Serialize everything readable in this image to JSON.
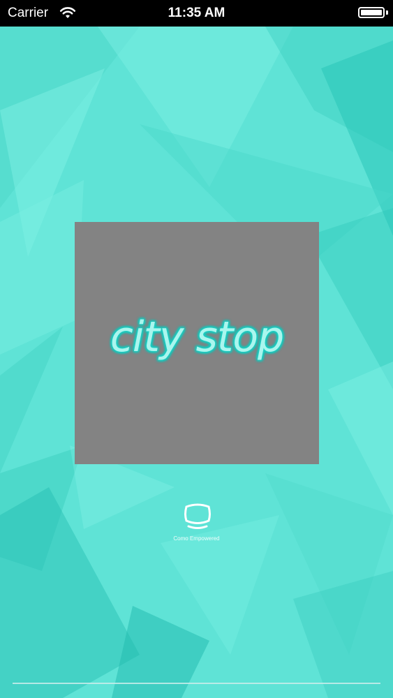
{
  "status_bar": {
    "carrier": "Carrier",
    "time": "11:35 AM",
    "wifi_icon": "wifi-icon",
    "battery_icon": "battery-icon"
  },
  "splash": {
    "logo_text": "city stop",
    "powered_by_text": "Como Empowered",
    "powered_icon": "como-logo-icon"
  },
  "colors": {
    "background": "#5fe3d6",
    "logo_card": "#838383",
    "logo_text": "#aaf6ee",
    "logo_glow": "#15bfb4"
  }
}
